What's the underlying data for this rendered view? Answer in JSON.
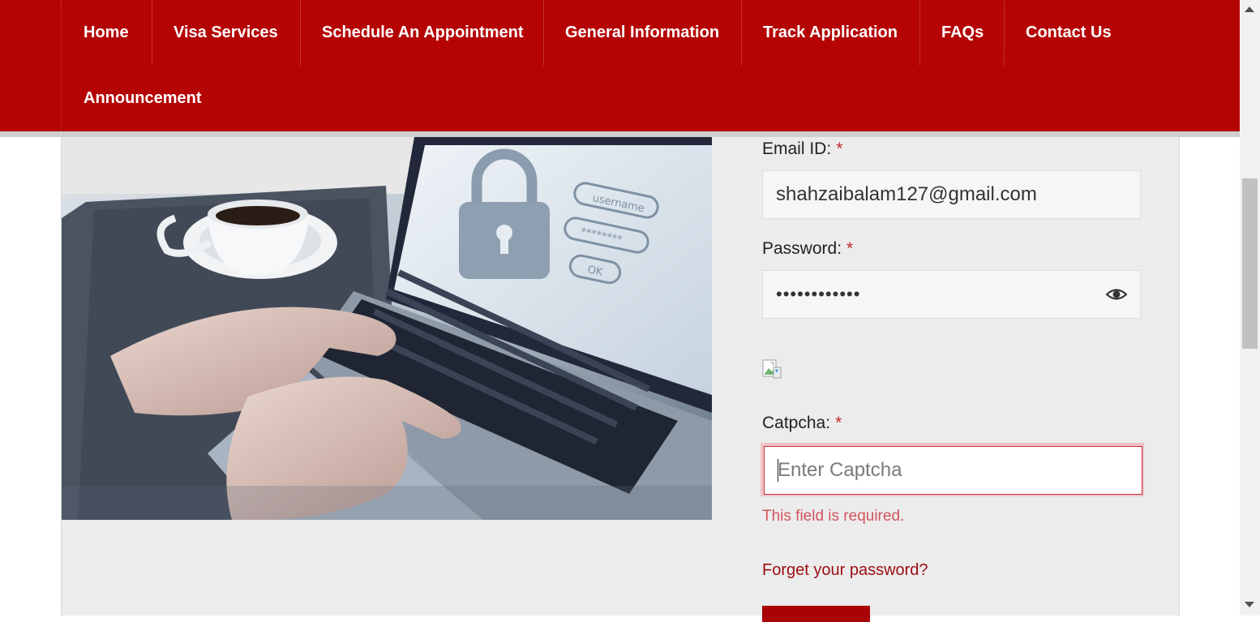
{
  "nav": {
    "items": [
      {
        "label": "Home"
      },
      {
        "label": "Visa Services"
      },
      {
        "label": "Schedule An Appointment"
      },
      {
        "label": "General Information"
      },
      {
        "label": "Track Application"
      },
      {
        "label": "FAQs"
      },
      {
        "label": "Contact Us"
      },
      {
        "label": "Announcement"
      }
    ]
  },
  "form": {
    "email": {
      "label": "Email ID:",
      "required_mark": "*",
      "value": "shahzaibalam127@gmail.com"
    },
    "password": {
      "label": "Password:",
      "required_mark": "*",
      "value": "••••••••••••"
    },
    "captcha": {
      "label": "Catpcha:",
      "required_mark": "*",
      "value": "",
      "placeholder": "Enter Captcha",
      "error": "This field is required."
    },
    "forgot_link": "Forget your password?"
  },
  "hero_image": {
    "screen_labels": [
      "username",
      "********",
      "OK"
    ]
  },
  "colors": {
    "brand_red": "#b50404",
    "error_red": "#d2555c",
    "link_red": "#9b0d12"
  },
  "icons": [
    "eye-icon",
    "broken-image-icon",
    "padlock-icon"
  ]
}
